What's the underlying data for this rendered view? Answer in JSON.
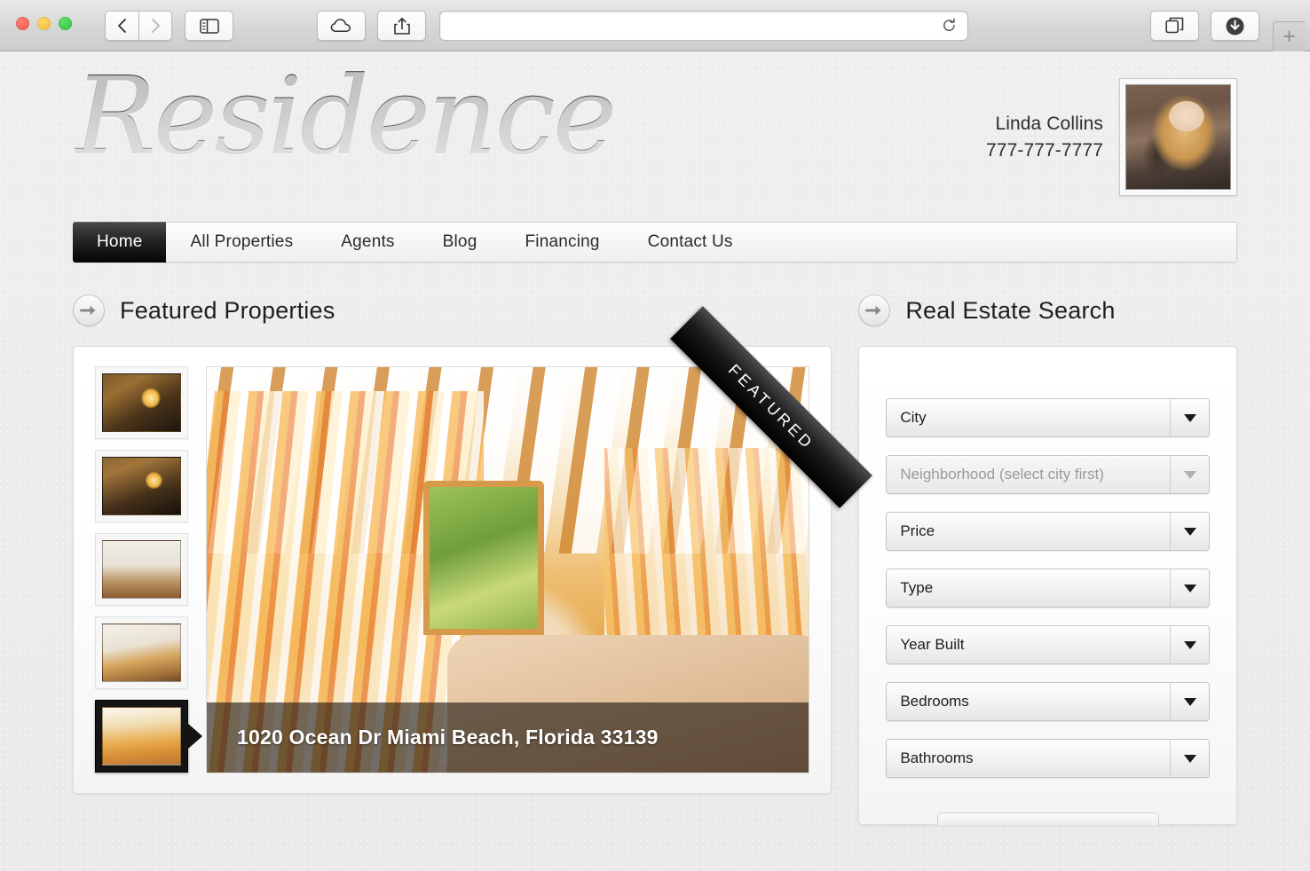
{
  "browser": {
    "window_controls": [
      "close",
      "minimize",
      "maximize"
    ],
    "back_label": "Back",
    "forward_label": "Forward",
    "sidebar_label": "Show Sidebar",
    "icloud_label": "iCloud Tabs",
    "share_label": "Share",
    "tabs_label": "Show Tab Overview",
    "downloads_label": "Downloads",
    "newtab_label": "+",
    "url_value": "",
    "url_placeholder": "",
    "reload_label": "Reload"
  },
  "site": {
    "logo_text": "Residence",
    "agent": {
      "name": "Linda Collins",
      "phone": "777-777-7777",
      "photo_alt": "Linda Collins headshot"
    },
    "nav": [
      {
        "label": "Home",
        "active": true
      },
      {
        "label": "All Properties",
        "active": false
      },
      {
        "label": "Agents",
        "active": false
      },
      {
        "label": "Blog",
        "active": false
      },
      {
        "label": "Financing",
        "active": false
      },
      {
        "label": "Contact Us",
        "active": false
      }
    ]
  },
  "featured": {
    "heading": "Featured Properties",
    "ribbon_label": "FEATURED",
    "address": "1020 Ocean Dr Miami Beach, Florida 33139",
    "thumbnails": [
      {
        "alt": "Warm wood-paneled lounge",
        "selected": false
      },
      {
        "alt": "Wood-paneled lounge with lamps",
        "selected": false
      },
      {
        "alt": "Entry hallway with arches",
        "selected": false
      },
      {
        "alt": "Open living area",
        "selected": false
      },
      {
        "alt": "Living room with striped curtains",
        "selected": true
      }
    ]
  },
  "search": {
    "heading": "Real Estate Search",
    "fields": [
      {
        "label": "City",
        "disabled": false
      },
      {
        "label": "Neighborhood (select city first)",
        "disabled": true
      },
      {
        "label": "Price",
        "disabled": false
      },
      {
        "label": "Type",
        "disabled": false
      },
      {
        "label": "Year Built",
        "disabled": false
      },
      {
        "label": "Bedrooms",
        "disabled": false
      },
      {
        "label": "Bathrooms",
        "disabled": false
      }
    ]
  },
  "colors": {
    "nav_active_bg": "#0a0a0a",
    "nav_text": "#2b2b2b",
    "page_bg": "#eeeeee",
    "panel_bg": "#ffffff",
    "ribbon_bg": "#111111",
    "caption_overlay": "rgba(30,22,16,0.62)"
  }
}
